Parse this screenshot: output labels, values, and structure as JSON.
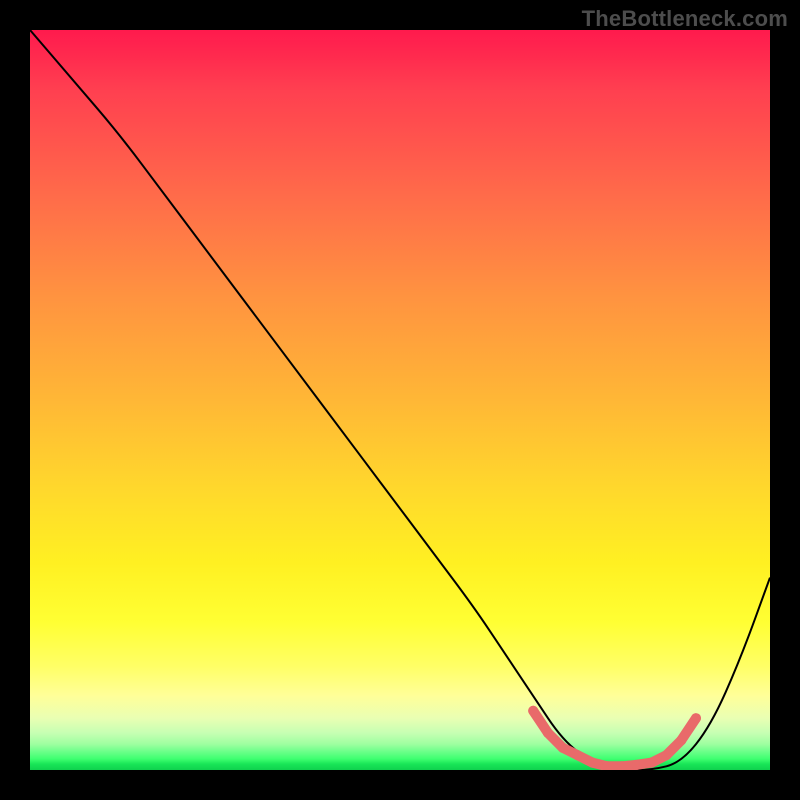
{
  "watermark": {
    "text": "TheBottleneck.com"
  },
  "colors": {
    "curve_stroke": "#000000",
    "optimal_marker": "#e96a6a",
    "background": "#000000"
  },
  "chart_data": {
    "type": "line",
    "title": "",
    "xlabel": "",
    "ylabel": "",
    "xlim": [
      0,
      100
    ],
    "ylim": [
      0,
      100
    ],
    "grid": false,
    "legend": false,
    "series": [
      {
        "name": "bottleneck-curve",
        "x": [
          0,
          6,
          12,
          18,
          24,
          30,
          36,
          42,
          48,
          54,
          60,
          64,
          68,
          72,
          76,
          80,
          84,
          88,
          92,
          96,
          100
        ],
        "y": [
          100,
          93,
          86,
          78,
          70,
          62,
          54,
          46,
          38,
          30,
          22,
          16,
          10,
          4,
          1,
          0,
          0,
          1,
          6,
          15,
          26
        ]
      },
      {
        "name": "optimal-range-markers",
        "x": [
          68,
          70,
          72,
          74,
          76,
          78,
          80,
          82,
          84,
          86,
          88,
          90
        ],
        "y": [
          8,
          5,
          3,
          2,
          1,
          0.5,
          0.5,
          0.7,
          1,
          2,
          4,
          7
        ]
      }
    ],
    "annotations": []
  }
}
